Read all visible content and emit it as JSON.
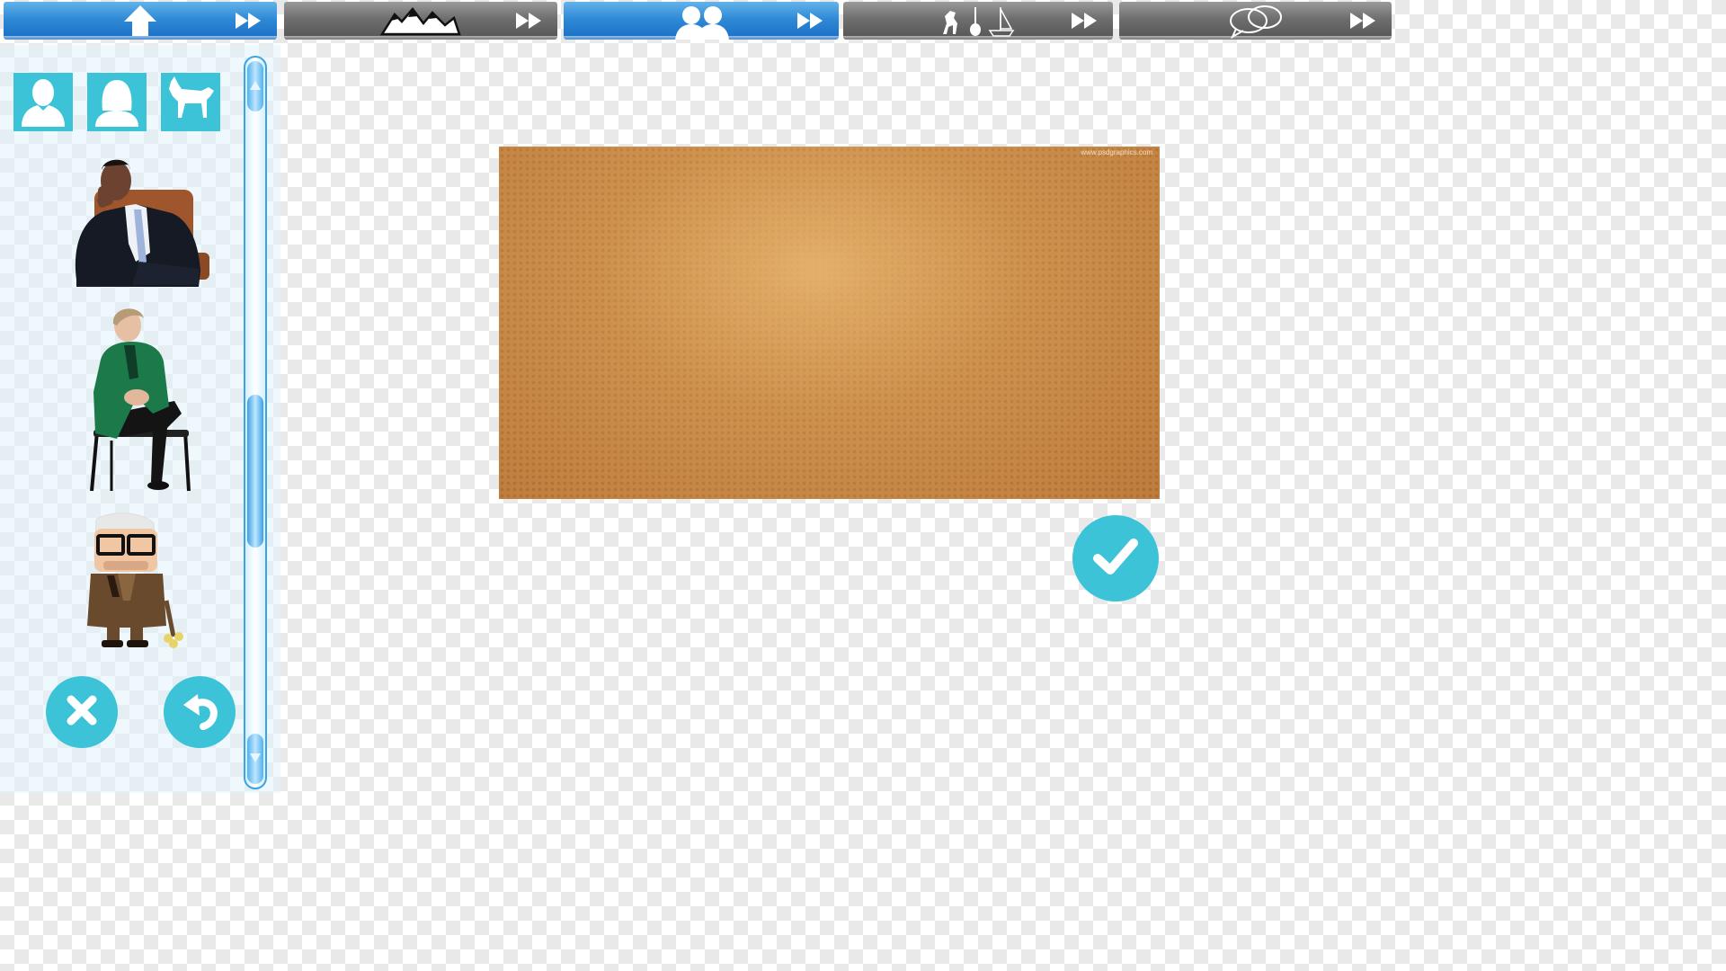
{
  "tabs": [
    {
      "icon": "home-icon",
      "state": "active"
    },
    {
      "icon": "mountains-icon",
      "state": "inactive"
    },
    {
      "icon": "people-icon",
      "state": "active"
    },
    {
      "icon": "objects-icon",
      "state": "inactive"
    },
    {
      "icon": "speech-bubbles-icon",
      "state": "inactive"
    }
  ],
  "sidebar": {
    "categories": [
      "man-icon",
      "woman-icon",
      "dog-icon"
    ],
    "items": [
      "person-seated-suit",
      "person-seated-green-jacket",
      "cartoon-old-man"
    ]
  },
  "canvas": {
    "watermark": "www.psdgraphics.com"
  },
  "colors": {
    "accent": "#3cc3d7",
    "tab_active": "#2f8ad6",
    "tab_inactive": "#6e6e6e",
    "scroll": "#3aa5e4"
  }
}
